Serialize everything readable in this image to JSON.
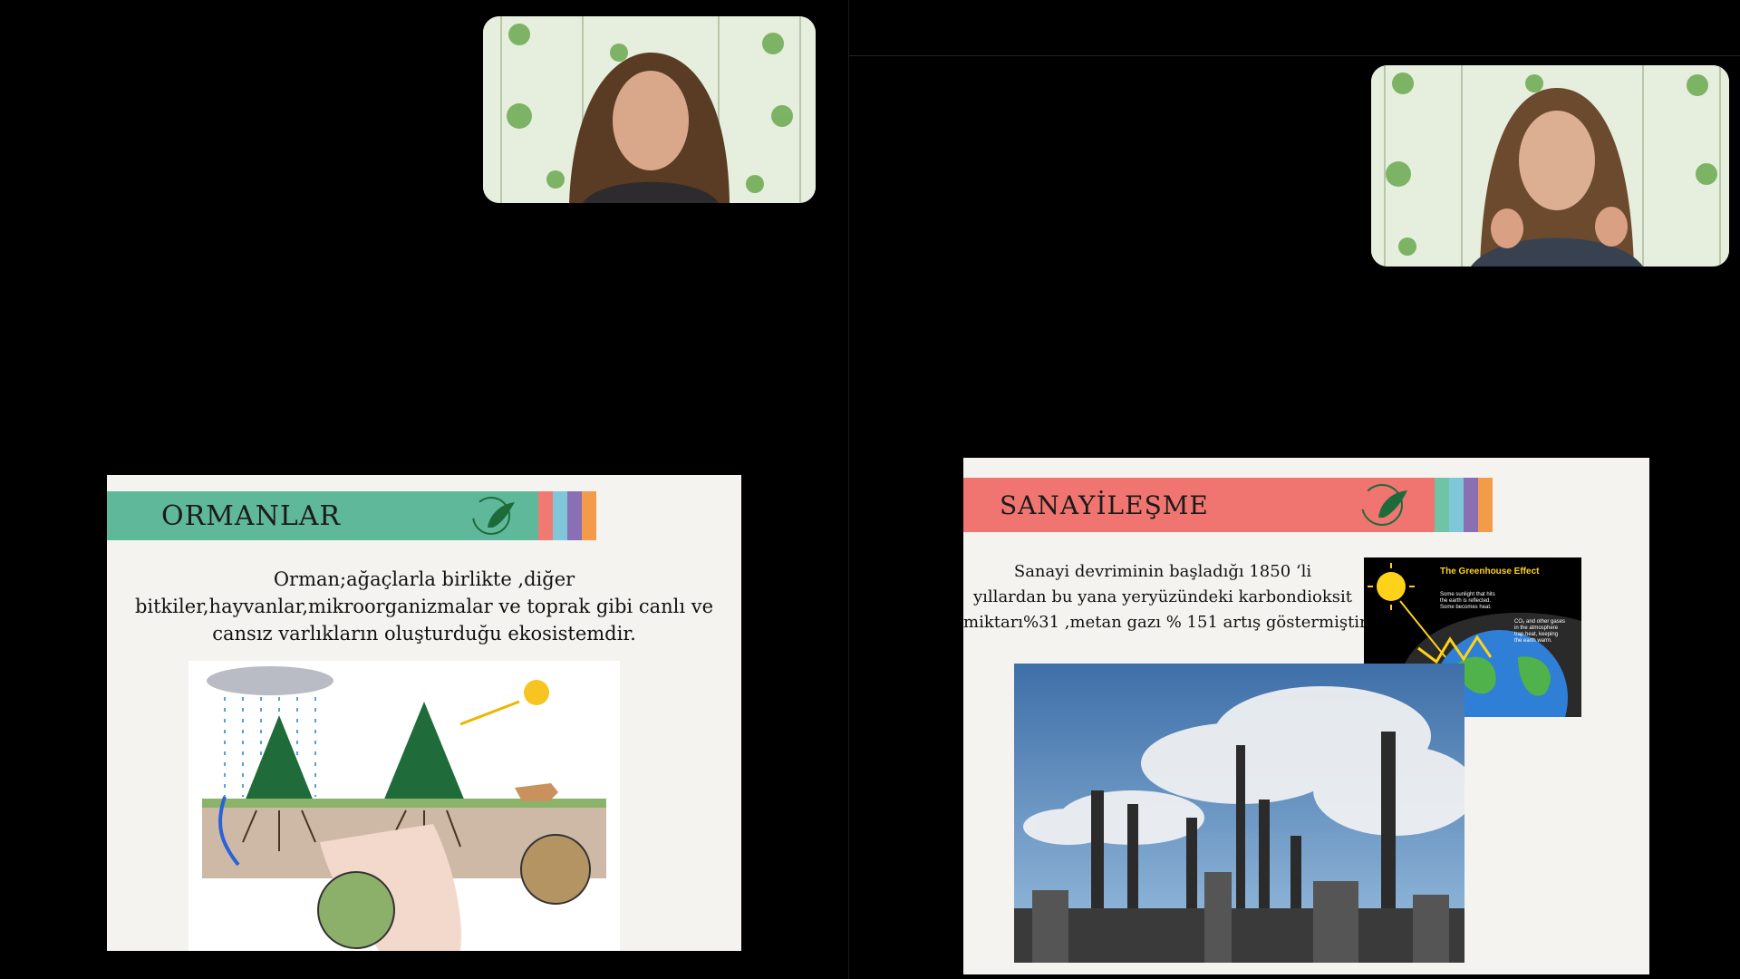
{
  "left": {
    "slide": {
      "title": "ORMANLAR",
      "text_lines": [
        "Orman;ağaçlarla birlikte ,diğer",
        "bitkiler,hayvanlar,mikroorganizmalar ve toprak gibi canlı ve",
        "cansız varlıkların oluşturduğu ekosistemdir."
      ],
      "band_color": "#5fb89a",
      "stripe_colors": [
        "#f07a72",
        "#7fc7d8",
        "#8a6fb5",
        "#f39a4b"
      ]
    }
  },
  "right": {
    "slide": {
      "title": "SANAYİLEŞME",
      "text_lines": [
        "Sanayi devriminin başladığı 1850 ‘li",
        "yıllardan bu yana yeryüzündeki karbondioksit",
        "miktarı%31 ,metan gazı % 151 artış göstermiştir."
      ],
      "band_color": "#f07570",
      "stripe_colors": [
        "#6fc4a5",
        "#7fc7d8",
        "#8a6fb5",
        "#f39a4b"
      ],
      "greenhouse": {
        "heading": "The Greenhouse Effect",
        "note1": [
          "Some sunlight that hits",
          "the earth is reflected.",
          "Some becomes heat."
        ],
        "note2": [
          "CO₂ and other gases",
          "in the atmosphere",
          "trap heat, keeping",
          "the earth warm."
        ]
      }
    }
  }
}
